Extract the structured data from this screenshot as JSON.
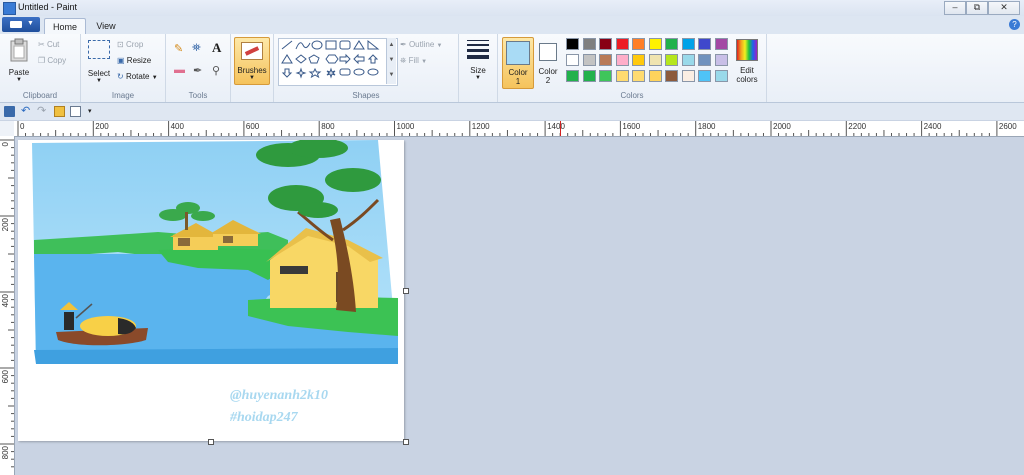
{
  "window": {
    "title": "Untitled - Paint",
    "controls": [
      "minimize",
      "maximize",
      "close"
    ]
  },
  "tabs": [
    {
      "label": "Home"
    },
    {
      "label": "View"
    }
  ],
  "clipboard": {
    "paste": "Paste",
    "cut": "Cut",
    "copy": "Copy",
    "group": "Clipboard"
  },
  "image": {
    "select": "Select",
    "crop": "Crop",
    "resize": "Resize",
    "rotate": "Rotate",
    "group": "Image"
  },
  "tools": {
    "group": "Tools"
  },
  "brushes": {
    "label": "Brushes"
  },
  "shapes": {
    "outline": "Outline",
    "fill": "Fill",
    "group": "Shapes"
  },
  "size": {
    "label": "Size"
  },
  "colors": {
    "color1": "Color",
    "color1_num": "1",
    "color2": "Color",
    "color2_num": "2",
    "edit1": "Edit",
    "edit2": "colors",
    "group": "Colors",
    "color1_value": "#a9dbf5",
    "color2_value": "#ffffff",
    "palette": [
      [
        "#000000",
        "#7f7f7f",
        "#880015",
        "#ed1c24",
        "#ff7f27",
        "#fff200",
        "#22b14c",
        "#00a2e8",
        "#3f48cc",
        "#a349a4"
      ],
      [
        "#ffffff",
        "#c3c3c3",
        "#b97a57",
        "#ffaec9",
        "#ffc90e",
        "#efe4b0",
        "#b5e61d",
        "#99d9ea",
        "#7092be",
        "#c8bfe7"
      ],
      [
        "#22b14c",
        "#22b14c",
        "#3fc55a",
        "#ffdb70",
        "#ffdb70",
        "#ffd35c",
        "#8c5a3c",
        "#fbeee3",
        "#4fc3f7",
        "#99d9ea"
      ]
    ]
  },
  "ruler": {
    "top": [
      "0",
      "200",
      "400",
      "600",
      "800",
      "1000",
      "1200",
      "1400",
      "1600",
      "1800",
      "2000",
      "2200",
      "2400",
      "2600"
    ],
    "left": [
      "0",
      "200",
      "400",
      "600",
      "800"
    ]
  },
  "canvas": {
    "watermark1": "@huyenanh2k10",
    "watermark2": "#hoidap247"
  }
}
